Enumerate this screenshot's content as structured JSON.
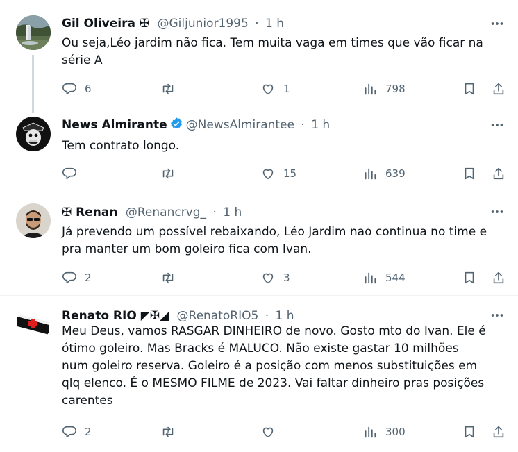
{
  "tweets": [
    {
      "name": "Gil Oliveira ✠",
      "handle": "@Giljunior1995",
      "time": "1 h",
      "text": "Ou seja,Léo jardim não fica. Tem muita vaga em times que vão ficar na série A",
      "replies": "6",
      "retweets": "",
      "likes": "1",
      "views": "798"
    },
    {
      "name": "News Almirante",
      "handle": "@NewsAlmirantee",
      "time": "1 h",
      "verified": true,
      "text": "Tem contrato longo.",
      "replies": "",
      "retweets": "",
      "likes": "15",
      "views": "639"
    },
    {
      "name": "✠ Renan",
      "handle": "@Renancrvg_",
      "time": "1 h",
      "text": "Já prevendo um possível rebaixando, Léo Jardim nao continua no time e pra manter um bom goleiro fica com Ivan.",
      "replies": "2",
      "retweets": "",
      "likes": "3",
      "views": "544"
    },
    {
      "name": "Renato RIO ◤✠◢",
      "handle": "@RenatoRIO5",
      "time": "1 h",
      "text": "Meu Deus, vamos RASGAR DINHEIRO de novo. Gosto mto do Ivan. Ele é ótimo goleiro. Mas Bracks é MALUCO. Não existe gastar 10 milhões num goleiro reserva. Goleiro é a posição com menos substituições em qlq elenco. É o MESMO FILME de 2023. Vai faltar dinheiro pras posições carentes",
      "replies": "2",
      "retweets": "",
      "likes": "",
      "views": "300"
    }
  ],
  "separator": "·",
  "colors": {
    "text": "#0f1419",
    "muted": "#536471",
    "verified": "#1d9bf0",
    "divider": "#eff3f4",
    "thread": "#cfd9de"
  },
  "icons": [
    "more-icon",
    "reply-icon",
    "retweet-icon",
    "like-icon",
    "views-icon",
    "bookmark-icon",
    "share-icon",
    "verified-icon"
  ]
}
